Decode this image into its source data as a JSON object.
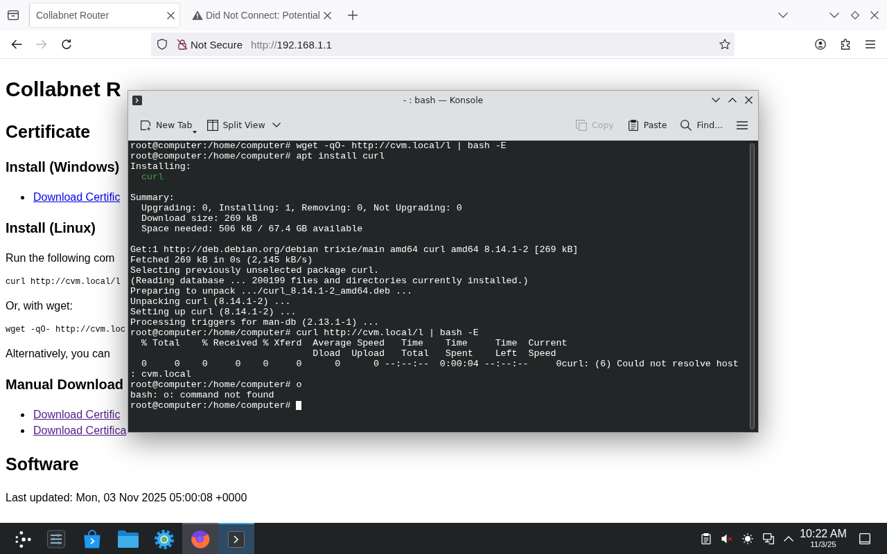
{
  "browser": {
    "tabs": [
      {
        "title": "Collabnet Router",
        "kind": "page",
        "selected": true
      },
      {
        "title": "Did Not Connect: Potential",
        "kind": "warning",
        "selected": false
      }
    ],
    "nav_buttons": [
      {
        "kind": "back",
        "disabled": false
      },
      {
        "kind": "forward",
        "disabled": true
      },
      {
        "kind": "reload",
        "disabled": false
      }
    ],
    "url_bar": {
      "security_label": "Not Secure",
      "scheme": "http://",
      "host": "192.168.1.1"
    }
  },
  "page": {
    "blocks": [
      {
        "kind": "h1",
        "text": "Collabnet R"
      },
      {
        "kind": "h2",
        "text": "Certificate"
      },
      {
        "kind": "h3",
        "text": "Install (Windows)"
      },
      {
        "kind": "links",
        "items": [
          {
            "text": "Download Certific",
            "visited": false
          }
        ]
      },
      {
        "kind": "h3",
        "text": "Install (Linux)"
      },
      {
        "kind": "paragraph",
        "text": "Run the following com"
      },
      {
        "kind": "code",
        "text": "curl http://cvm.local/l"
      },
      {
        "kind": "paragraph",
        "text": "Or, with wget:"
      },
      {
        "kind": "code",
        "text": "wget -qO- http://cvm.loc"
      },
      {
        "kind": "paragraph",
        "text": "Alternatively, you can"
      },
      {
        "kind": "h3",
        "text": "Manual Download"
      },
      {
        "kind": "links",
        "items": [
          {
            "text": "Download Certific",
            "visited": true
          },
          {
            "text": "Download Certifica",
            "visited": true
          }
        ]
      },
      {
        "kind": "h2",
        "text": "Software"
      },
      {
        "kind": "paragraph",
        "text": "Last updated: Mon, 03 Nov 2025 05:00:08 +0000"
      }
    ]
  },
  "konsole": {
    "title": "- : bash — Konsole",
    "toolbar_left": [
      {
        "kind": "new-tab",
        "label": "New Tab",
        "disabled": false
      },
      {
        "kind": "split-view",
        "label": "Split View",
        "disabled": false
      }
    ],
    "toolbar_right": [
      {
        "kind": "copy",
        "label": "Copy",
        "disabled": true
      },
      {
        "kind": "paste",
        "label": "Paste",
        "disabled": false
      },
      {
        "kind": "find",
        "label": "Find...",
        "disabled": false
      }
    ],
    "terminal": {
      "cursor": true,
      "blocks": [
        {
          "lines": [
            {
              "text": "root@computer:/home/computer# wget -qO- http://cvm.local/l | bash -E",
              "color": "#fcfcfc"
            },
            {
              "text": "root@computer:/home/computer# apt install curl",
              "color": "#fcfcfc"
            },
            {
              "text": "Installing:",
              "color": "#fcfcfc"
            },
            {
              "text": "  curl",
              "color": "#2fa33f"
            }
          ]
        },
        {
          "lines": [
            {
              "text": "Summary:",
              "color": "#fcfcfc"
            },
            {
              "text": "  Upgrading: 0, Installing: 1, Removing: 0, Not Upgrading: 0",
              "color": "#fcfcfc"
            },
            {
              "text": "  Download size: 269 kB",
              "color": "#fcfcfc"
            },
            {
              "text": "  Space needed: 506 kB / 67.4 GB available",
              "color": "#fcfcfc"
            }
          ]
        },
        {
          "lines": [
            {
              "text": "Get:1 http://deb.debian.org/debian trixie/main amd64 curl amd64 8.14.1-2 [269 kB]",
              "color": "#fcfcfc"
            },
            {
              "text": "Fetched 269 kB in 0s (2,145 kB/s)",
              "color": "#fcfcfc"
            },
            {
              "text": "Selecting previously unselected package curl.",
              "color": "#fcfcfc"
            },
            {
              "text": "(Reading database ... 200199 files and directories currently installed.)",
              "color": "#fcfcfc"
            },
            {
              "text": "Preparing to unpack .../curl_8.14.1-2_amd64.deb ...",
              "color": "#fcfcfc"
            },
            {
              "text": "Unpacking curl (8.14.1-2) ...",
              "color": "#fcfcfc"
            },
            {
              "text": "Setting up curl (8.14.1-2) ...",
              "color": "#fcfcfc"
            },
            {
              "text": "Processing triggers for man-db (2.13.1-1) ...",
              "color": "#fcfcfc"
            },
            {
              "text": "root@computer:/home/computer# curl http://cvm.local/l | bash -E",
              "color": "#fcfcfc"
            },
            {
              "text": "  % Total    % Received % Xferd  Average Speed   Time    Time     Time  Current",
              "color": "#fcfcfc"
            },
            {
              "text": "                                 Dload  Upload   Total   Spent    Left  Speed",
              "color": "#fcfcfc"
            },
            {
              "text": "  0     0    0     0    0     0      0      0 --:--:--  0:00:04 --:--:--     0curl: (6) Could not resolve host",
              "color": "#fcfcfc"
            },
            {
              "text": ": cvm.local",
              "color": "#fcfcfc"
            },
            {
              "text": "root@computer:/home/computer# o",
              "color": "#fcfcfc"
            },
            {
              "text": "bash: o: command not found",
              "color": "#fcfcfc"
            },
            {
              "text": "root@computer:/home/computer# ",
              "color": "#fcfcfc"
            }
          ]
        }
      ]
    }
  },
  "taskbar": {
    "apps": [
      {
        "kind": "launcher",
        "open": false,
        "selected": false
      },
      {
        "kind": "sliders",
        "open": false,
        "selected": false
      },
      {
        "kind": "store",
        "open": false,
        "selected": false
      },
      {
        "kind": "folder",
        "open": false,
        "selected": false
      },
      {
        "kind": "settings",
        "open": false,
        "selected": false
      },
      {
        "kind": "browser",
        "open": true,
        "selected": false
      },
      {
        "kind": "terminal",
        "open": true,
        "selected": true
      }
    ],
    "clock": {
      "time": "10:22 AM",
      "date": "11/3/25"
    }
  }
}
